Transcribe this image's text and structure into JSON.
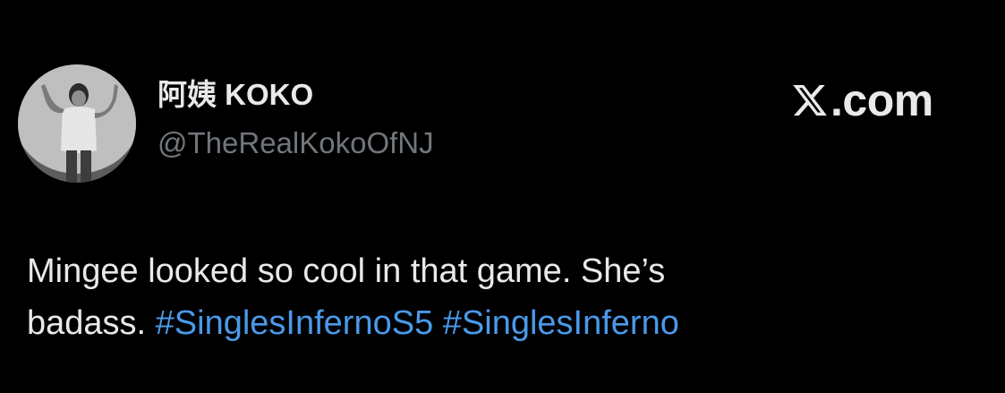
{
  "author": {
    "display_name": "阿姨 KOKO",
    "handle": "@TheRealKokoOfNJ",
    "avatar_icon": "profile-photo"
  },
  "brand": {
    "icon": "x-logo-icon",
    "text": ".com"
  },
  "tweet": {
    "line1": "Mingee looked so cool in that game. She’s",
    "line2_text": "badass. ",
    "hashtags": [
      "#SinglesInfernoS5",
      "#SinglesInferno"
    ]
  },
  "colors": {
    "background": "#000000",
    "text": "#e7e9ea",
    "muted": "#71767b",
    "link": "#4a99e9"
  }
}
